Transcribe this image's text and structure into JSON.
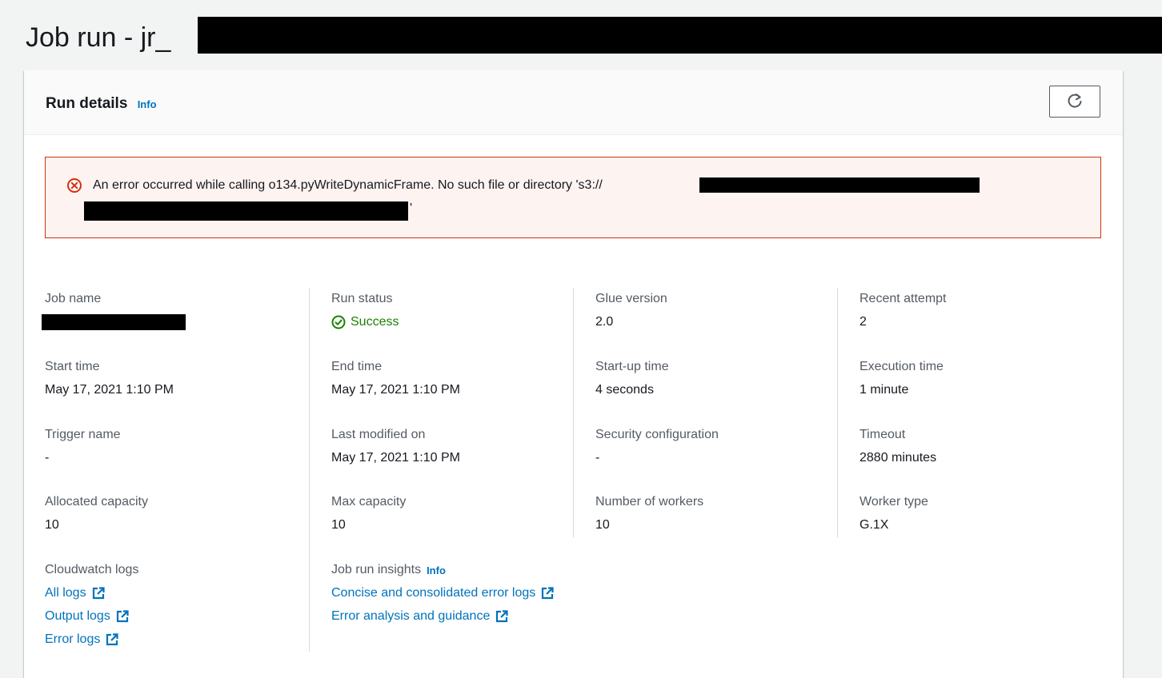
{
  "page": {
    "title": "Job run - jr_"
  },
  "panel": {
    "title": "Run details",
    "info_label": "Info"
  },
  "alert": {
    "message": "An error occurred while calling o134.pyWriteDynamicFrame. No such file or directory 's3://",
    "closing_quote": "'"
  },
  "fields": {
    "job_name": {
      "label": "Job name"
    },
    "run_status": {
      "label": "Run status",
      "value": "Success"
    },
    "glue_version": {
      "label": "Glue version",
      "value": "2.0"
    },
    "recent_attempt": {
      "label": "Recent attempt",
      "value": "2"
    },
    "start_time": {
      "label": "Start time",
      "value": "May 17, 2021 1:10 PM"
    },
    "end_time": {
      "label": "End time",
      "value": "May 17, 2021 1:10 PM"
    },
    "startup_time": {
      "label": "Start-up time",
      "value": "4 seconds"
    },
    "execution_time": {
      "label": "Execution time",
      "value": "1 minute"
    },
    "trigger_name": {
      "label": "Trigger name",
      "value": "-"
    },
    "last_modified": {
      "label": "Last modified on",
      "value": "May 17, 2021 1:10 PM"
    },
    "security_config": {
      "label": "Security configuration",
      "value": "-"
    },
    "timeout": {
      "label": "Timeout",
      "value": "2880 minutes"
    },
    "allocated_capacity": {
      "label": "Allocated capacity",
      "value": "10"
    },
    "max_capacity": {
      "label": "Max capacity",
      "value": "10"
    },
    "num_workers": {
      "label": "Number of workers",
      "value": "10"
    },
    "worker_type": {
      "label": "Worker type",
      "value": "G.1X"
    }
  },
  "cloudwatch": {
    "label": "Cloudwatch logs",
    "links": [
      "All logs",
      "Output logs",
      "Error logs"
    ]
  },
  "insights": {
    "label": "Job run insights",
    "info_label": "Info",
    "links": [
      "Concise and consolidated error logs",
      "Error analysis and guidance"
    ]
  },
  "colors": {
    "link": "#0073bb",
    "success": "#1d8102",
    "error": "#d13212",
    "error_bg": "#fdf3f1"
  }
}
